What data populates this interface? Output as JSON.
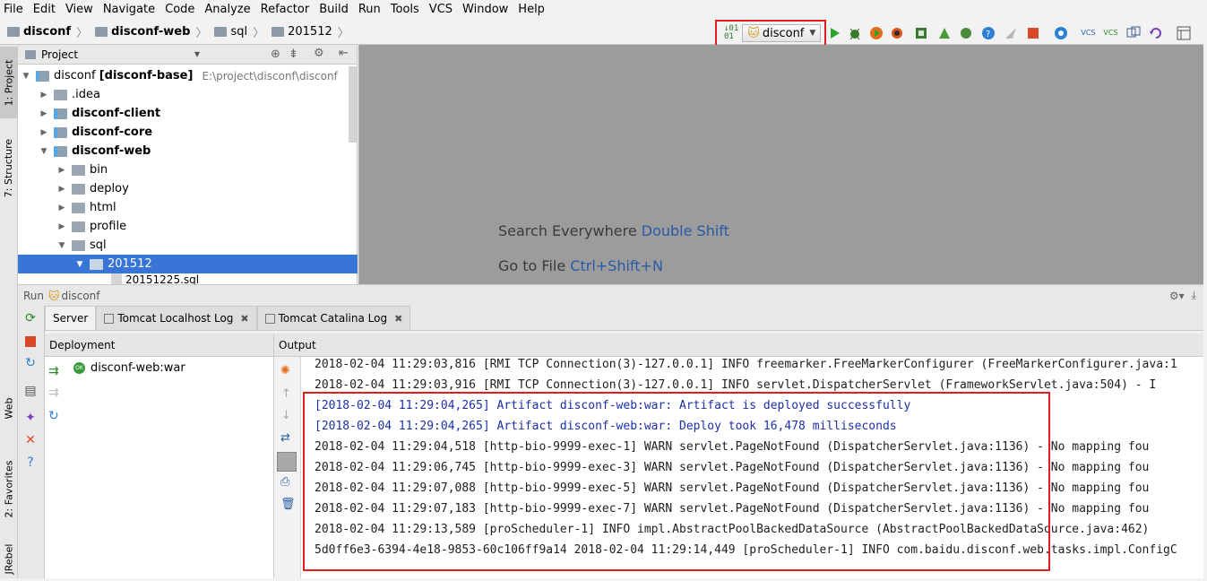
{
  "menu": [
    "File",
    "Edit",
    "View",
    "Navigate",
    "Code",
    "Analyze",
    "Refactor",
    "Build",
    "Run",
    "Tools",
    "VCS",
    "Window",
    "Help"
  ],
  "breadcrumb": [
    "disconf",
    "disconf-web",
    "sql",
    "201512"
  ],
  "run_config": "disconf",
  "project_panel": {
    "title": "Project",
    "root_name": "disconf",
    "root_module": "[disconf-base]",
    "root_path": "E:\\project\\disconf\\disconf",
    "items": [
      ".idea",
      "disconf-client",
      "disconf-core",
      "disconf-web",
      "bin",
      "deploy",
      "html",
      "profile",
      "sql",
      "201512",
      "20151225.sql"
    ]
  },
  "side_tabs": {
    "project": "1: Project",
    "structure": "7: Structure",
    "web": "Web",
    "favorites": "2: Favorites",
    "jrebel": "JRebel"
  },
  "editor_hints": {
    "search_label": "Search Everywhere",
    "search_key": "Double Shift",
    "goto_label": "Go to File",
    "goto_key": "Ctrl+Shift+N"
  },
  "run_panel": {
    "label": "Run",
    "config": "disconf",
    "tabs": [
      "Server",
      "Tomcat Localhost Log",
      "Tomcat Catalina Log"
    ],
    "deployment_header": "Deployment",
    "output_header": "Output",
    "deployment_item": "disconf-web:war",
    "ok_badge": "OK"
  },
  "console_lines": [
    "2018-02-04 11:29:03,816 [RMI TCP Connection(3)-127.0.0.1] INFO  freemarker.FreeMarkerConfigurer (FreeMarkerConfigurer.java:1",
    "2018-02-04 11:29:03,916 [RMI TCP Connection(3)-127.0.0.1] INFO  servlet.DispatcherServlet (FrameworkServlet.java:504)     - I",
    "[2018-02-04 11:29:04,265] Artifact disconf-web:war: Artifact is deployed successfully",
    "[2018-02-04 11:29:04,265] Artifact disconf-web:war: Deploy took 16,478 milliseconds",
    "2018-02-04 11:29:04,518 [http-bio-9999-exec-1] WARN  servlet.PageNotFound (DispatcherServlet.java:1136)      - No mapping fou",
    "2018-02-04 11:29:06,745 [http-bio-9999-exec-3] WARN  servlet.PageNotFound (DispatcherServlet.java:1136)      - No mapping fou",
    "2018-02-04 11:29:07,088 [http-bio-9999-exec-5] WARN  servlet.PageNotFound (DispatcherServlet.java:1136)      - No mapping fou",
    "2018-02-04 11:29:07,183 [http-bio-9999-exec-7] WARN  servlet.PageNotFound (DispatcherServlet.java:1136)      - No mapping fou",
    "2018-02-04 11:29:13,589 [proScheduler-1] INFO  impl.AbstractPoolBackedDataSource (AbstractPoolBackedDataSource.java:462)",
    "5d0ff6e3-6394-4e18-9853-60c106ff9a14 2018-02-04 11:29:14,449 [proScheduler-1] INFO  com.baidu.disconf.web.tasks.impl.ConfigC"
  ],
  "colors": {
    "selection": "#3875d7",
    "highlight_box": "#e01f1f",
    "link": "#2a5aa6",
    "artifact_text": "#1d2fa6"
  }
}
